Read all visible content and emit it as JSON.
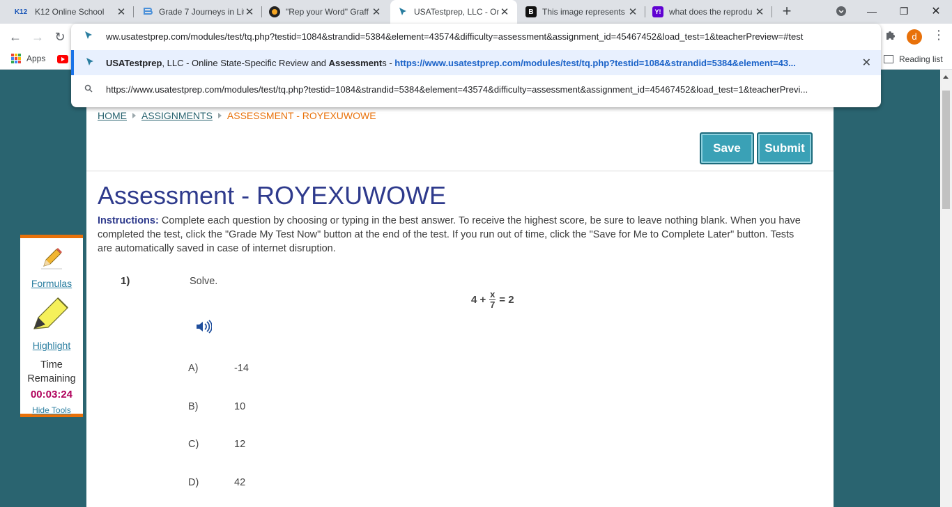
{
  "browser": {
    "tabs": [
      {
        "title": "K12 Online School",
        "favicon": "K12"
      },
      {
        "title": "Grade 7 Journeys in Lit",
        "favicon": "B"
      },
      {
        "title": "\"Rep your Word\" Graff",
        "favicon": "R"
      },
      {
        "title": "USATestprep, LLC - On",
        "favicon": "cursor"
      },
      {
        "title": "This image represents",
        "favicon": "B"
      },
      {
        "title": "what does the reprodu",
        "favicon": "Y!"
      }
    ],
    "active_tab_index": 3,
    "address_text": "ww.usatestprep.com/modules/test/tq.php?testid=1084&strandid=5384&element=43574&difficulty=assessment&assignment_id=45467452&load_test=1&teacherPreview=#test",
    "suggestion_title_parts": [
      "USATestprep",
      ", LLC - Online State-Specific Review and ",
      "Assessment",
      "s - "
    ],
    "suggestion_url": "https://www.usatestprep.com/modules/test/tq.php?testid=1084&strandid=5384&element=43...",
    "suggestion_search": "https://www.usatestprep.com/modules/test/tq.php?testid=1084&strandid=5384&element=43574&difficulty=assessment&assignment_id=45467452&load_test=1&teacherPrevi...",
    "avatar_letter": "d",
    "bookmarks": [
      {
        "label": "Apps"
      }
    ],
    "reading_list": "Reading list"
  },
  "breadcrumb": {
    "home": "HOME",
    "assignments": "ASSIGNMENTS",
    "current": "ASSESSMENT - ROYEXUWOWE"
  },
  "actions": {
    "save": "Save",
    "submit": "Submit"
  },
  "page_title": "Assessment - ROYEXUWOWE",
  "instructions": {
    "label": "Instructions:",
    "text": " Complete each question by choosing or typing in the best answer. To receive the highest score, be sure to leave nothing blank. When you have completed the test, click the \"Grade My Test Now\" button at the end of the test. If you run out of time, click the \"Save for Me to Complete Later\" button. Tests are automatically saved in case of internet disruption."
  },
  "question": {
    "number": "1)",
    "prompt": "Solve.",
    "equation": {
      "left": "4 +",
      "numerator": "x",
      "denominator": "7",
      "right": "= 2"
    },
    "options": [
      {
        "letter": "A)",
        "value": "-14"
      },
      {
        "letter": "B)",
        "value": "10"
      },
      {
        "letter": "C)",
        "value": "12"
      },
      {
        "letter": "D)",
        "value": "42"
      }
    ]
  },
  "tools": {
    "formulas": "Formulas",
    "highlight": "Highlight",
    "time_label": "Time Remaining",
    "time_remaining": "00:03:24",
    "hide_tools": "Hide Tools"
  },
  "colors": {
    "accent_teal": "#2a6470",
    "button": "#3aa1b6",
    "title_navy": "#2e3a8c",
    "orange": "#e8710a",
    "timer": "#b0005b"
  }
}
